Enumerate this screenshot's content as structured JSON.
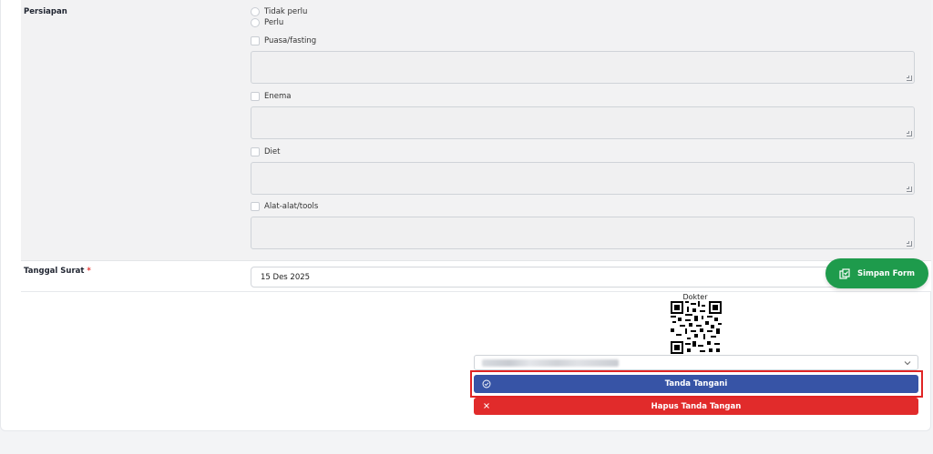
{
  "preparation": {
    "label": "Persiapan",
    "radio_options": [
      "Tidak perlu",
      "Perlu"
    ],
    "checkbox_items": [
      {
        "label": "Puasa/fasting",
        "notes": ""
      },
      {
        "label": "Enema",
        "notes": ""
      },
      {
        "label": "Diet",
        "notes": ""
      },
      {
        "label": "Alat-alat/tools",
        "notes": ""
      }
    ]
  },
  "letter_date": {
    "label": "Tanggal Surat",
    "required_mark": "*",
    "value": "15 Des 2025"
  },
  "save_button": {
    "label": "Simpan Form",
    "icon": "save-file-icon",
    "color": "#1e9b4c"
  },
  "signature": {
    "role_label": "Dokter",
    "qr_icon": "qr-code-icon",
    "doctor_select_value": "",
    "sign_button": {
      "label": "Tanda Tangani",
      "icon": "check-circle-icon",
      "color": "#3754a6"
    },
    "remove_button": {
      "label": "Hapus Tanda Tangan",
      "icon": "close-icon",
      "color": "#e12b2b"
    }
  }
}
